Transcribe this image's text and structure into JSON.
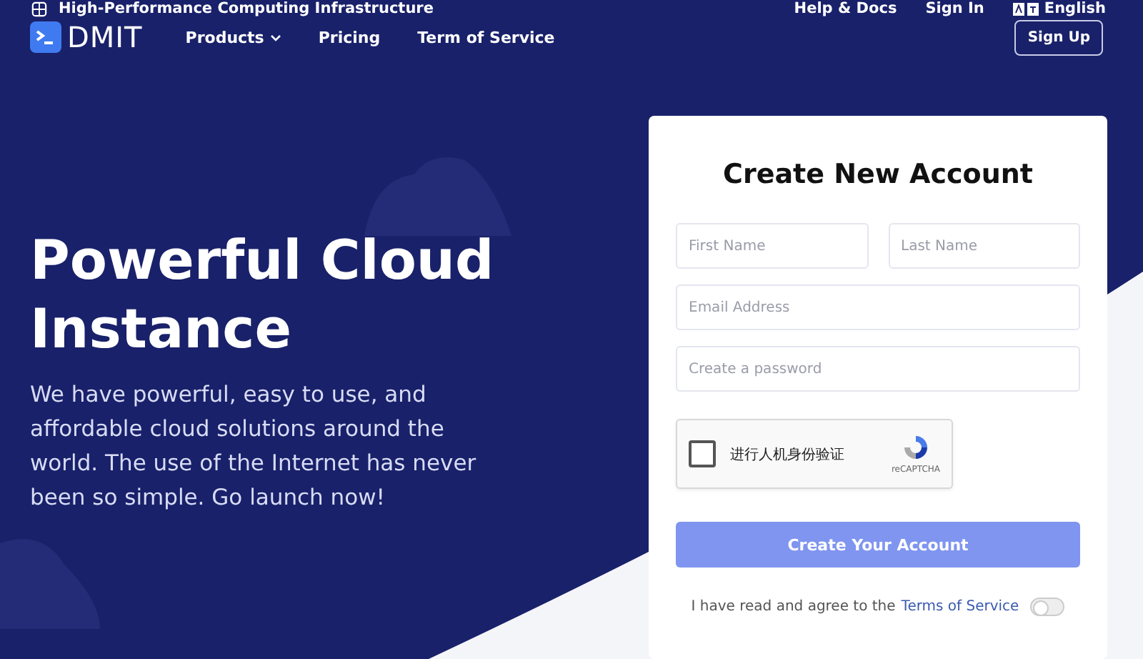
{
  "top_bar": {
    "tagline": "High-Performance Computing Infrastructure",
    "links": [
      "Help & Docs",
      "Sign In"
    ],
    "language": "English"
  },
  "nav": {
    "logo": "DMIT",
    "items": [
      {
        "label": "Products",
        "kind": "dropdown"
      },
      {
        "label": "Pricing",
        "kind": "link"
      },
      {
        "label": "Term of Service",
        "kind": "link"
      }
    ],
    "sign_up": "Sign Up"
  },
  "hero": {
    "title": "Powerful Cloud Instance",
    "text": "We have powerful, easy to use, and affordable cloud solutions around the world. The use of the Internet has never been so simple. Go launch now!"
  },
  "form": {
    "title": "Create New Account",
    "name_fields": [
      {
        "placeholder": "First Name"
      },
      {
        "placeholder": "Last Name"
      }
    ],
    "fields": [
      {
        "placeholder": "Email Address"
      },
      {
        "placeholder": "Create a password"
      }
    ],
    "captcha": {
      "label": "进行人机身份验证",
      "checked": false,
      "brand": "reCAPTCHA"
    },
    "submit": {
      "label": "Create Your Account",
      "disabled": true
    },
    "agree": {
      "text": "I have read and agree to the",
      "link": "Terms of Service",
      "on": false
    }
  }
}
